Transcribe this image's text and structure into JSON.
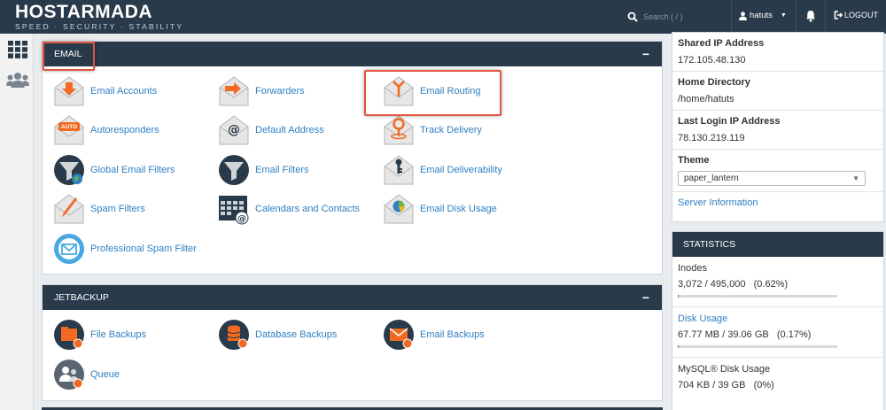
{
  "header": {
    "brand_name": "HOSTARMADA",
    "brand_tagline": "SPEED · SECURITY · STABILITY",
    "search_placeholder": "Search ( / )",
    "user_label": "hatuts",
    "logout_label": "LOGOUT"
  },
  "rail": {
    "icons": [
      "apps-grid-icon",
      "users-icon"
    ]
  },
  "email": {
    "title": "EMAIL",
    "collapse": "−",
    "items": [
      {
        "label": "Email Accounts",
        "icon": "email-accounts-icon"
      },
      {
        "label": "Forwarders",
        "icon": "forwarders-icon"
      },
      {
        "label": "Email Routing",
        "icon": "email-routing-icon"
      },
      {
        "label": "Autoresponders",
        "icon": "autoresponders-icon"
      },
      {
        "label": "Default Address",
        "icon": "default-address-icon"
      },
      {
        "label": "Track Delivery",
        "icon": "track-delivery-icon"
      },
      {
        "label": "Global Email Filters",
        "icon": "global-filter-icon"
      },
      {
        "label": "Email Filters",
        "icon": "filter-icon"
      },
      {
        "label": "Email Deliverability",
        "icon": "deliverability-icon"
      },
      {
        "label": "Spam Filters",
        "icon": "spam-filters-icon"
      },
      {
        "label": "Calendars and Contacts",
        "icon": "calendar-icon"
      },
      {
        "label": "Email Disk Usage",
        "icon": "disk-usage-icon"
      },
      {
        "label": "Professional Spam Filter",
        "icon": "professional-spam-filter-icon"
      }
    ],
    "auto_badge": "AUTO"
  },
  "jetbackup": {
    "title": "JETBACKUP",
    "collapse": "−",
    "items": [
      {
        "label": "File Backups",
        "icon": "file-backups-icon"
      },
      {
        "label": "Database Backups",
        "icon": "database-backups-icon"
      },
      {
        "label": "Email Backups",
        "icon": "email-backups-icon"
      },
      {
        "label": "Queue",
        "icon": "queue-icon"
      }
    ]
  },
  "info": {
    "shared_ip_label": "Shared IP Address",
    "shared_ip_value": "172.105.48.130",
    "home_dir_label": "Home Directory",
    "home_dir_value": "/home/hatuts",
    "last_login_label": "Last Login IP Address",
    "last_login_value": "78.130.219.119",
    "theme_label": "Theme",
    "theme_value": "paper_lantern",
    "server_info_link": "Server Information"
  },
  "statistics": {
    "title": "STATISTICS",
    "items": [
      {
        "label": "Inodes",
        "value": "3,072 / 495,000   (0.62%)",
        "fraction": 0.0062,
        "link": false
      },
      {
        "label": "Disk Usage",
        "value": "67.77 MB / 39.06 GB   (0.17%)",
        "fraction": 0.0017,
        "link": true
      },
      {
        "label": "MySQL® Disk Usage",
        "value": "704 KB / 39 GB   (0%)",
        "fraction": 0,
        "link": false
      }
    ]
  },
  "colors": {
    "navy": "#293a4a",
    "link": "#2f7fc1",
    "highlight": "#e0563f",
    "orange": "#f26a21"
  }
}
